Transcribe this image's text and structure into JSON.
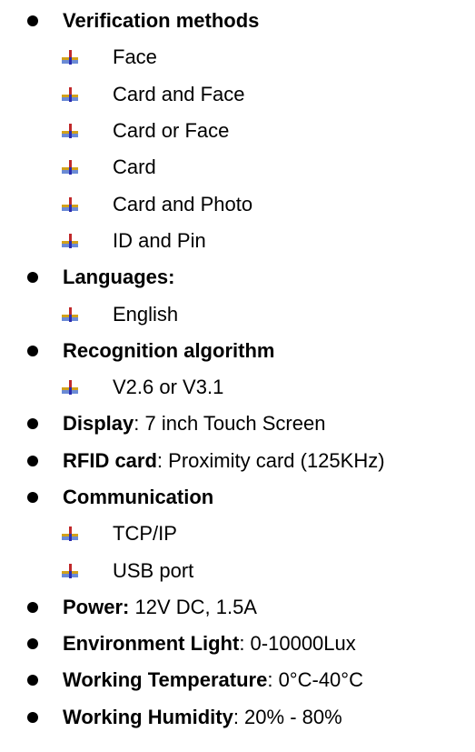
{
  "verification": {
    "title": "Verification methods",
    "items": [
      "Face",
      "Card and Face",
      "Card or Face",
      "Card",
      "Card and Photo",
      "ID and Pin"
    ]
  },
  "languages": {
    "title": "Languages:",
    "items": [
      "English"
    ]
  },
  "algorithm": {
    "title": "Recognition algorithm",
    "items": [
      "V2.6 or V3.1"
    ]
  },
  "display": {
    "label": "Display",
    "value": ": 7 inch Touch Screen"
  },
  "rfid": {
    "label": "RFID card",
    "value": ": Proximity card (125KHz)"
  },
  "communication": {
    "title": "Communication",
    "items": [
      "TCP/IP",
      "USB port"
    ]
  },
  "power": {
    "label": "Power:",
    "value": " 12V DC, 1.5A"
  },
  "light": {
    "label": "Environment Light",
    "value": ": 0-10000Lux"
  },
  "temperature": {
    "label": "Working Temperature",
    "value": ": 0°C-40°C"
  },
  "humidity": {
    "label": "Working Humidity",
    "value": ": 20% - 80%"
  }
}
